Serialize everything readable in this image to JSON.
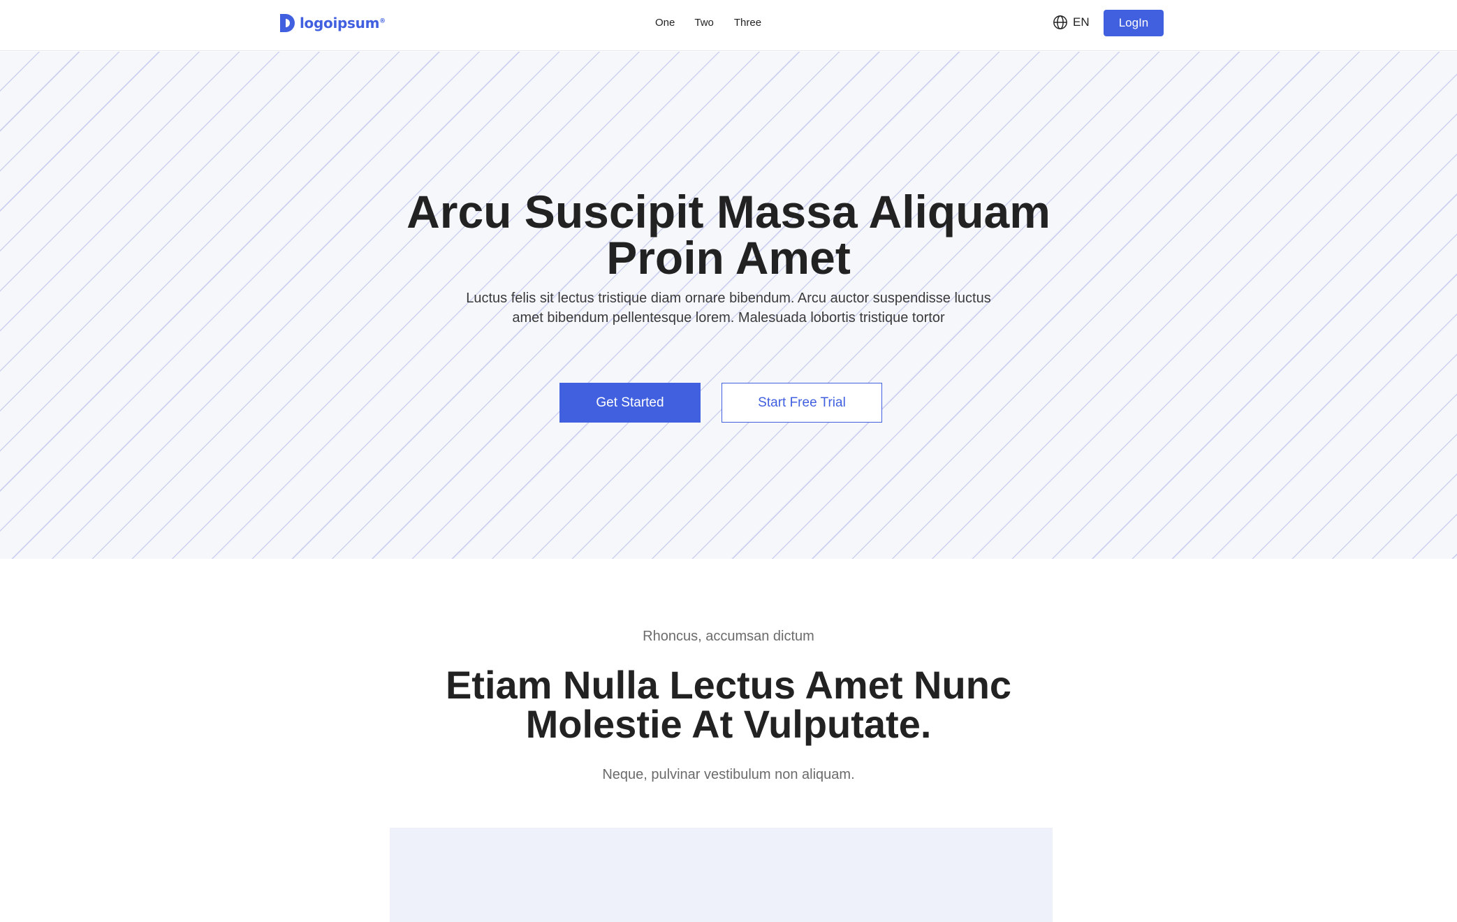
{
  "colors": {
    "accent": "#4160e0",
    "hero_bg": "#f5f7fb",
    "media_bg": "#eef1fa"
  },
  "navbar": {
    "logo_text": "logoipsum",
    "logo_mark": "®",
    "links": [
      "One",
      "Two",
      "Three"
    ],
    "language_icon": "globe-icon",
    "language": "EN",
    "login_label": "LogIn"
  },
  "hero": {
    "title_line1": "Arcu Suscipit Massa Aliquam",
    "title_line2": "Proin Amet",
    "subtitle": "Luctus felis sit lectus tristique diam ornare bibendum. Arcu auctor suspendisse luctus amet bibendum pellentesque lorem. Malesuada lobortis tristique tortor",
    "primary_cta": "Get Started",
    "secondary_cta": "Start Free Trial"
  },
  "section": {
    "eyebrow": "Rhoncus, accumsan dictum",
    "title_line1": "Etiam Nulla Lectus Amet Nunc",
    "title_line2": "Molestie At Vulputate.",
    "subtitle": "Neque, pulvinar vestibulum non aliquam."
  }
}
